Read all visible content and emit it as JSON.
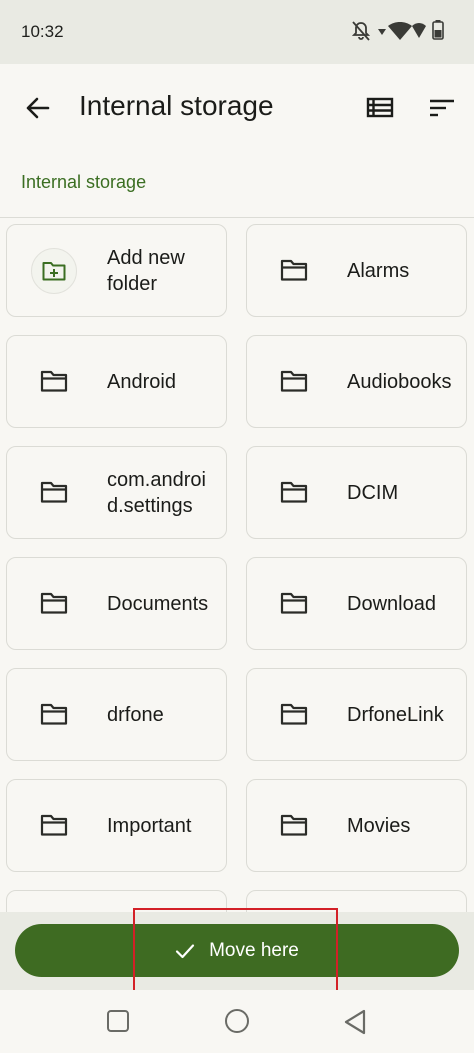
{
  "status_bar": {
    "time": "10:32",
    "icons": [
      "bell-off-icon",
      "wifi-icon",
      "battery-icon"
    ]
  },
  "app_bar": {
    "title": "Internal storage",
    "back_icon": "arrow-back-icon",
    "view_icon": "list-view-icon",
    "sort_icon": "sort-icon"
  },
  "breadcrumb": "Internal storage",
  "items": [
    {
      "label": "Add new\nfolder",
      "icon": "create-folder-icon"
    },
    {
      "label": "Alarms",
      "icon": "folder-icon"
    },
    {
      "label": "Android",
      "icon": "folder-icon"
    },
    {
      "label": "Audiobooks",
      "icon": "folder-icon"
    },
    {
      "label": "com.android.settings",
      "icon": "folder-icon"
    },
    {
      "label": "DCIM",
      "icon": "folder-icon"
    },
    {
      "label": "Documents",
      "icon": "folder-icon"
    },
    {
      "label": "Download",
      "icon": "folder-icon"
    },
    {
      "label": "drfone",
      "icon": "folder-icon"
    },
    {
      "label": "DrfoneLink",
      "icon": "folder-icon"
    },
    {
      "label": "Important",
      "icon": "folder-icon"
    },
    {
      "label": "Movies",
      "icon": "folder-icon"
    }
  ],
  "action": {
    "label": "Move here",
    "icon": "check-icon",
    "color": "#3e6b22"
  },
  "highlight_color": "#d32027",
  "nav_bar": [
    "recents-icon",
    "home-icon",
    "back-triangle-icon"
  ]
}
